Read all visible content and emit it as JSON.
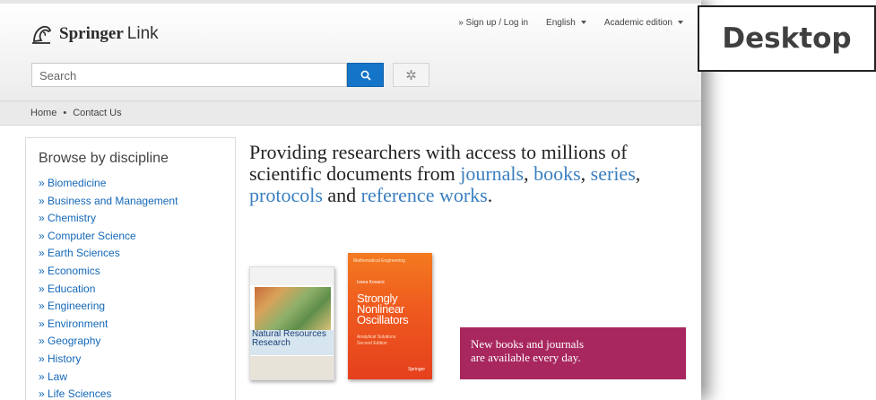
{
  "header": {
    "logo_springer": "Springer",
    "logo_link": "Link",
    "signup": "» Sign up / Log in",
    "language": "English",
    "edition": "Academic edition"
  },
  "search": {
    "placeholder": "Search"
  },
  "breadcrumb": {
    "home": "Home",
    "contact": "Contact Us"
  },
  "sidebar": {
    "title": "Browse by discipline",
    "items": [
      "» Biomedicine",
      "» Business and Management",
      "» Chemistry",
      "» Computer Science",
      "» Earth Sciences",
      "» Economics",
      "» Education",
      "» Engineering",
      "» Environment",
      "» Geography",
      "» History",
      "» Law",
      "» Life Sciences"
    ]
  },
  "main": {
    "headline_part1": "Providing researchers with access to millions of scientific documents from ",
    "link_journals": "journals",
    "sep1": ", ",
    "link_books": "books",
    "sep2": ", ",
    "link_series": "series",
    "sep3": ", ",
    "link_protocols": "protocols",
    "sep4": " and ",
    "link_reference": "reference works",
    "end": ".",
    "book1_title_line1": "Natural Resources",
    "book1_title_line2": "Research",
    "book2_series": "Mathematical Engineering",
    "book2_author": "Ivana Kovacic",
    "book2_title_line1": "Strongly",
    "book2_title_line2": "Nonlinear",
    "book2_title_line3": "Oscillators",
    "book2_sub1": "Analytical Solutions",
    "book2_sub2": "Second Edition",
    "book2_pub": "Springer",
    "promo_line1": "New books and journals",
    "promo_line2": "are available every day."
  },
  "label": {
    "desktop": "Desktop"
  },
  "colors": {
    "accent": "#1474c7",
    "link": "#3a7fc0",
    "promo": "#a8275f"
  }
}
